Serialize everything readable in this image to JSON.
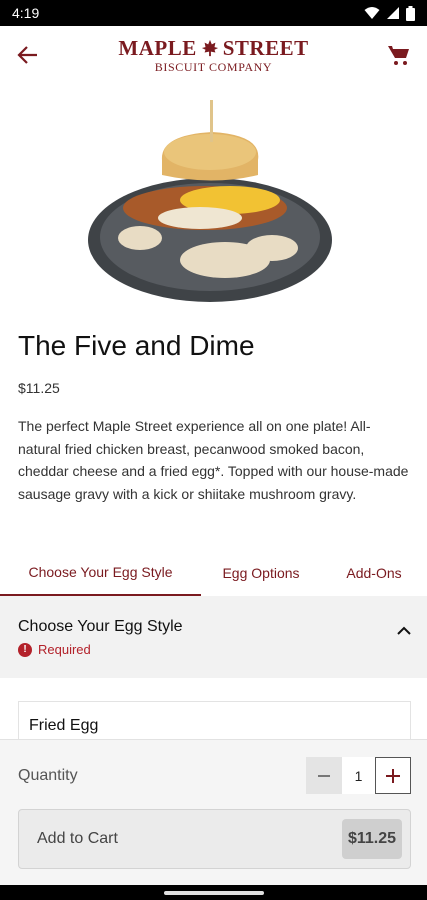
{
  "status": {
    "time": "4:19"
  },
  "header": {
    "brand_main_left": "MAPLE",
    "brand_main_right": "STREET",
    "brand_sub": "BISCUIT COMPANY"
  },
  "product": {
    "title": "The Five and Dime",
    "price": "$11.25",
    "description": "The perfect Maple Street experience all on one plate! All-natural fried chicken breast, pecanwood smoked bacon, cheddar cheese and a fried egg*. Topped with our house-made sausage gravy with a kick or shiitake mushroom gravy."
  },
  "tabs": [
    {
      "label": "Choose Your Egg Style",
      "active": true
    },
    {
      "label": "Egg Options",
      "active": false
    },
    {
      "label": "Add-Ons",
      "active": false
    }
  ],
  "section": {
    "title": "Choose Your Egg Style",
    "required_label": "Required",
    "required_icon": "!"
  },
  "options": [
    {
      "label": "Fried Egg"
    }
  ],
  "quantity": {
    "label": "Quantity",
    "value": "1"
  },
  "cart": {
    "label": "Add to Cart",
    "price": "$11.25"
  },
  "colors": {
    "brand": "#7a1a1f",
    "required": "#b3212a"
  }
}
